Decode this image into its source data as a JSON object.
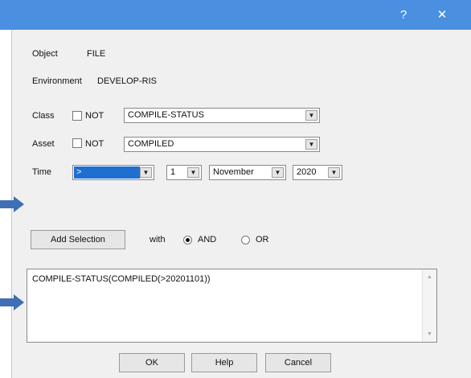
{
  "window": {
    "help_glyph": "?",
    "close_glyph": "✕"
  },
  "object": {
    "label": "Object",
    "value": "FILE"
  },
  "environment": {
    "label": "Environment",
    "value": "DEVELOP-RIS"
  },
  "class": {
    "label": "Class",
    "not_label": "NOT",
    "value": "COMPILE-STATUS",
    "not_checked": false
  },
  "asset": {
    "label": "Asset",
    "not_label": "NOT",
    "value": "COMPILED",
    "not_checked": false
  },
  "time": {
    "label": "Time",
    "operator": ">",
    "day": "1",
    "month": "November",
    "year": "2020"
  },
  "add_selection_label": "Add Selection",
  "with_label": "with",
  "logic": {
    "and_label": "AND",
    "or_label": "OR",
    "selected": "AND"
  },
  "expression": "COMPILE-STATUS(COMPILED(>20201101))",
  "buttons": {
    "ok": "OK",
    "help": "Help",
    "cancel": "Cancel"
  },
  "colors": {
    "titlebar": "#4a8fe0",
    "selection": "#1f6fd1",
    "arrow": "#3f6fb5"
  },
  "icons": {
    "dropdown": "▼",
    "scroll_up": "▲",
    "scroll_down": "▼",
    "arrow": "arrow-right-icon"
  }
}
